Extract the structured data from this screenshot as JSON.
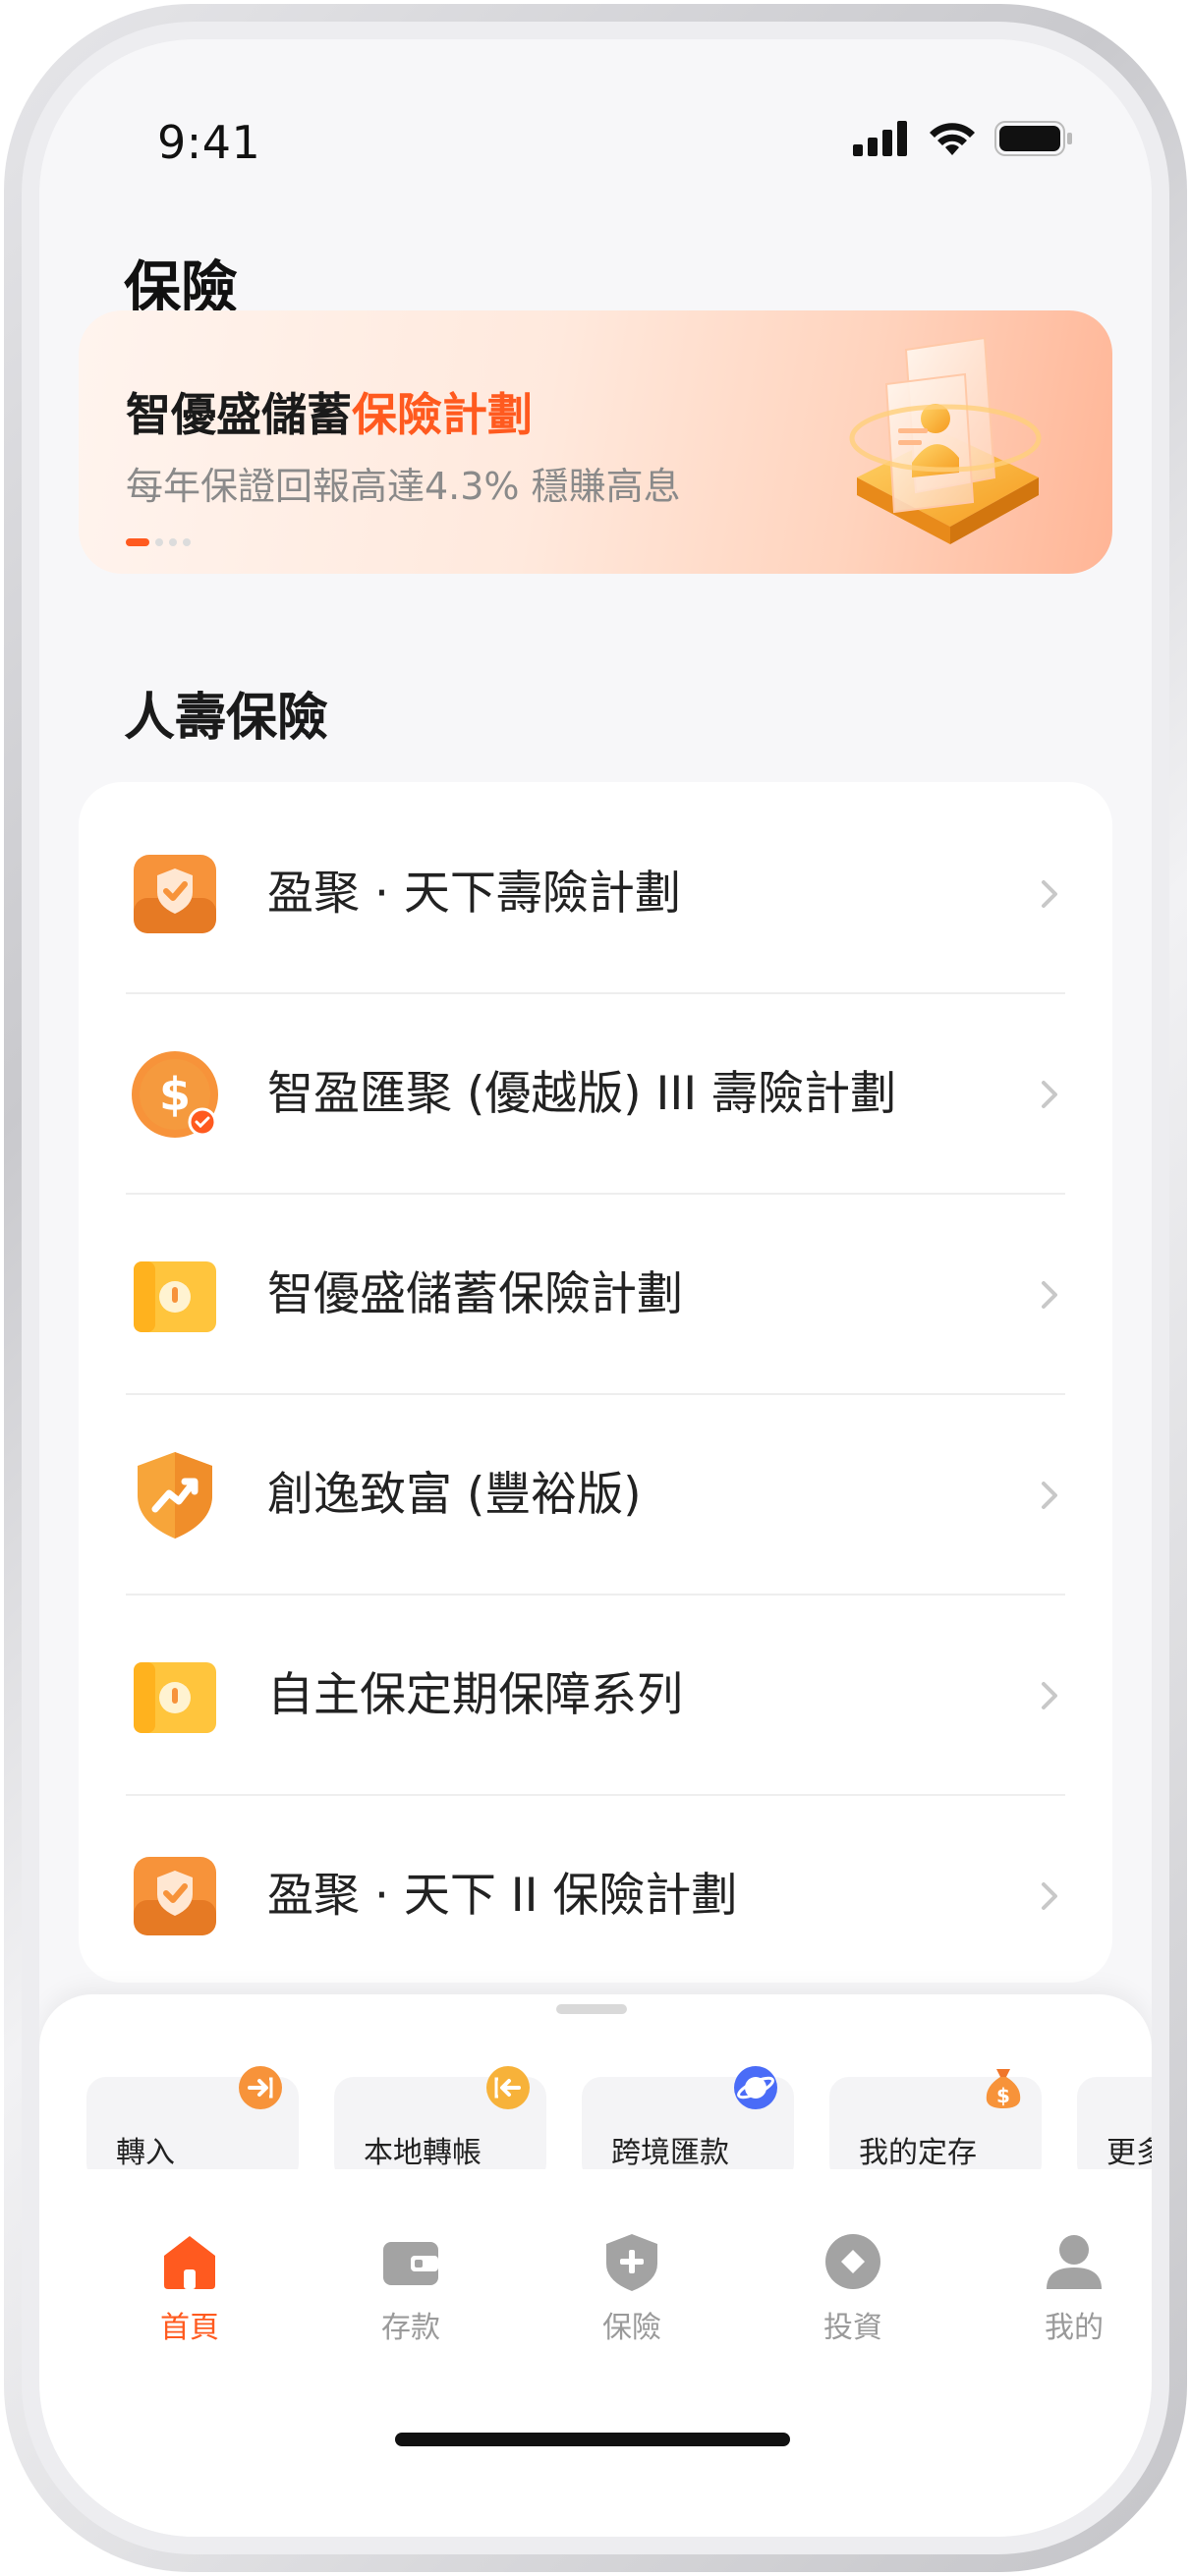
{
  "status_bar": {
    "time": "9:41"
  },
  "page": {
    "title": "保險"
  },
  "banner": {
    "title_main": "智優盛儲蓄",
    "title_highlight": "保險計劃",
    "subtitle": "每年保證回報高達4.3% 穩賺高息",
    "carousel_index": 1,
    "carousel_count": 4
  },
  "section": {
    "title": "人壽保險"
  },
  "life_insurance_list": [
    {
      "label": "盈聚 · 天下壽險計劃",
      "icon": "shield-tray-icon"
    },
    {
      "label": "智盈匯聚 (優越版) III 壽險計劃",
      "icon": "dollar-coin-icon"
    },
    {
      "label": "智優盛儲蓄保險計劃",
      "icon": "safe-box-icon"
    },
    {
      "label": "創逸致富 (豐裕版)",
      "icon": "growth-shield-icon"
    },
    {
      "label": "自主保定期保障系列",
      "icon": "safe-box-icon"
    },
    {
      "label": "盈聚 · 天下 II 保險計劃",
      "icon": "shield-tray-icon"
    }
  ],
  "shortcuts": [
    {
      "label": "轉入",
      "icon": "transfer-in-icon"
    },
    {
      "label": "本地轉帳",
      "icon": "transfer-out-icon"
    },
    {
      "label": "跨境匯款",
      "icon": "globe-icon"
    },
    {
      "label": "我的定存",
      "icon": "money-bag-icon"
    },
    {
      "label": "更多",
      "icon": "more-icon"
    }
  ],
  "tabs": [
    {
      "label": "首頁",
      "icon": "home-icon",
      "active": true
    },
    {
      "label": "存款",
      "icon": "wallet-icon",
      "active": false
    },
    {
      "label": "保險",
      "icon": "shield-plus-icon",
      "active": false
    },
    {
      "label": "投資",
      "icon": "invest-icon",
      "active": false
    },
    {
      "label": "我的",
      "icon": "user-icon",
      "active": false
    }
  ],
  "colors": {
    "accent": "#ff5a1f",
    "icon_orange": "#f7933a",
    "icon_yellow": "#ffc53d",
    "tab_inactive": "#9a9a9a"
  }
}
